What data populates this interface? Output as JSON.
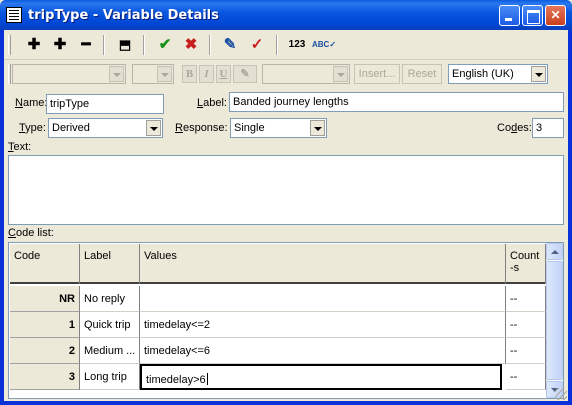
{
  "window": {
    "title": "tripType - Variable Details"
  },
  "toolbar": {
    "icons": [
      "add-icon",
      "add-multiple-icon",
      "remove-icon",
      "move-up-icon",
      "accept-icon",
      "cancel-icon",
      "edit-icon",
      "check-icon",
      "renumber-icon",
      "spell-check-icon"
    ],
    "insert_label": "Insert...",
    "reset_label": "Reset",
    "language": "English (UK)",
    "bold": "B",
    "italic": "I",
    "underline": "U"
  },
  "form": {
    "name_label": "Name:",
    "name_value": "tripType",
    "label_label": "Label:",
    "label_value": "Banded journey lengths",
    "type_label": "Type:",
    "type_value": "Derived",
    "response_label": "Response:",
    "response_value": "Single",
    "codes_label": "Codes:",
    "codes_value": "3",
    "text_label": "Text:",
    "code_list_label": "Code list:"
  },
  "grid": {
    "headers": [
      "Code",
      "Label",
      "Values",
      "Count-s"
    ],
    "rows": [
      {
        "code": "NR",
        "label": "No reply",
        "values": "",
        "counts": "--"
      },
      {
        "code": "1",
        "label": "Quick trip",
        "values": "timedelay<=2",
        "counts": "--"
      },
      {
        "code": "2",
        "label": "Medium ...",
        "values": "timedelay<=6",
        "counts": "--"
      },
      {
        "code": "3",
        "label": "Long trip",
        "values": "timedelay>6",
        "counts": "--"
      }
    ]
  },
  "colors": {
    "titlebar": "#0a58e0",
    "face": "#ece9d8",
    "accept": "#1a8f1a",
    "cancel": "#c81e1e"
  }
}
